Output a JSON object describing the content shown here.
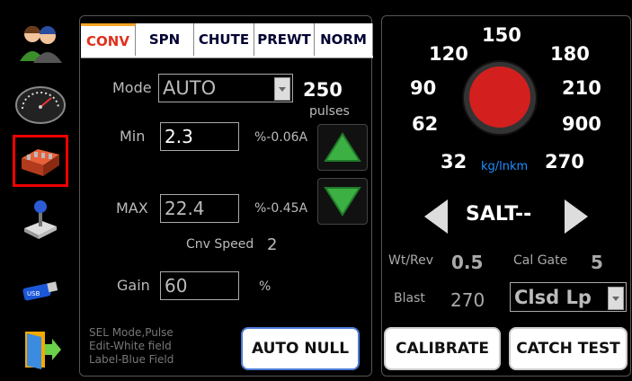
{
  "tabs": [
    "CONV",
    "SPN",
    "CHUTE",
    "PREWT",
    "NORM"
  ],
  "active_tab": "CONV",
  "sidebar_icons": [
    "users-icon",
    "speedometer-icon",
    "valve-block-icon",
    "joystick-icon",
    "usb-drive-icon",
    "exit-door-icon"
  ],
  "conv": {
    "mode_label": "Mode",
    "mode_value": "AUTO",
    "pulses_value": "250",
    "pulses_label": "pulses",
    "min_label": "Min",
    "min_value": "2.3",
    "min_unit": "%-0.06A",
    "max_label": "MAX",
    "max_value": "22.4",
    "max_unit": "%-0.45A",
    "cnv_speed_label": "Cnv Speed",
    "cnv_speed_value": "2",
    "gain_label": "Gain",
    "gain_value": "60",
    "gain_unit": "%",
    "note_lines": [
      "SEL Mode,Pulse",
      "Edit-White field",
      "Label-Blue Field"
    ],
    "auto_null_label": "AUTO NULL"
  },
  "dial": {
    "values": [
      "32",
      "62",
      "90",
      "120",
      "150",
      "180",
      "210",
      "900",
      "270"
    ],
    "unit": "kg/lnkm",
    "indicator_color": "#d41f1f"
  },
  "material": {
    "label": "SALT--"
  },
  "stats": {
    "wt_rev_label": "Wt/Rev",
    "wt_rev_value": "0.5",
    "cal_gate_label": "Cal Gate",
    "cal_gate_value": "5",
    "blast_label": "Blast",
    "blast_value": "270",
    "loop_value": "Clsd Lp"
  },
  "calibrate_label": "CALIBRATE",
  "catch_test_label": "CATCH TEST",
  "colors": {
    "active_tab_text": "#e0301e",
    "active_tab_bar": "#f5a623",
    "arrow_green": "#3cb043",
    "unit_blue": "#1e90ff",
    "selected_outline": "#e00000"
  }
}
